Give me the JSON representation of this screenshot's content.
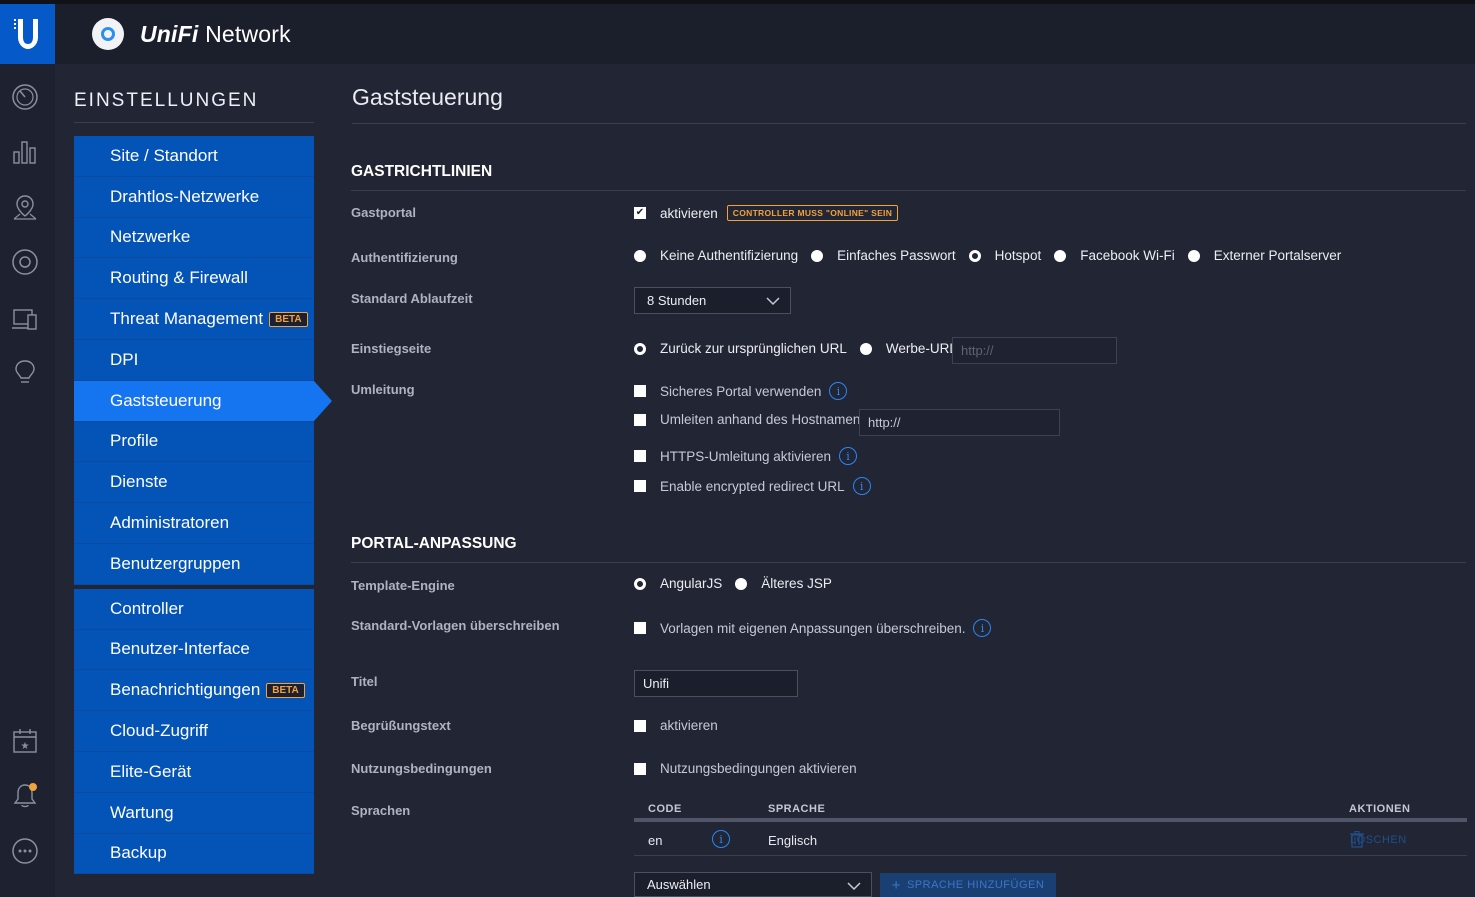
{
  "app": {
    "brand_prefix": "UniFi",
    "brand_suffix": "Network"
  },
  "sidebar": {
    "title": "EINSTELLUNGEN",
    "group1": [
      {
        "label": "Site / Standort"
      },
      {
        "label": "Drahtlos-Netzwerke"
      },
      {
        "label": "Netzwerke"
      },
      {
        "label": "Routing & Firewall"
      },
      {
        "label": "Threat Management",
        "badge": "BETA"
      },
      {
        "label": "DPI"
      },
      {
        "label": "Gaststeuerung",
        "active": true
      },
      {
        "label": "Profile"
      },
      {
        "label": "Dienste"
      },
      {
        "label": "Administratoren"
      },
      {
        "label": "Benutzergruppen"
      }
    ],
    "group2": [
      {
        "label": "Controller"
      },
      {
        "label": "Benutzer-Interface"
      },
      {
        "label": "Benachrichtigungen",
        "badge": "BETA"
      },
      {
        "label": "Cloud-Zugriff"
      },
      {
        "label": "Elite-Gerät"
      },
      {
        "label": "Wartung"
      },
      {
        "label": "Backup"
      }
    ]
  },
  "page": {
    "title": "Gaststeuerung"
  },
  "guest_policies": {
    "title": "GASTRICHTLINIEN",
    "gastportal": {
      "label": "Gastportal",
      "checkbox": "aktivieren",
      "checked": true,
      "badge": "CONTROLLER MUSS \"ONLINE\" SEIN"
    },
    "auth": {
      "label": "Authentifizierung",
      "options": [
        "Keine Authentifizierung",
        "Einfaches Passwort",
        "Hotspot",
        "Facebook Wi-Fi",
        "Externer Portalserver"
      ],
      "selected": "Hotspot"
    },
    "expiry": {
      "label": "Standard Ablaufzeit",
      "value": "8 Stunden"
    },
    "landing": {
      "label": "Einstiegseite",
      "option1": "Zurück zur ursprünglichen URL",
      "option2": "Werbe-URL",
      "selected": "Zurück zur ursprünglichen URL",
      "url_placeholder": "http://"
    },
    "redirect": {
      "label": "Umleitung",
      "secure_portal": "Sicheres Portal verwenden",
      "by_hostname": "Umleiten anhand des Hostnamen",
      "hostname_value": "http://",
      "https_redirect": "HTTPS-Umleitung aktivieren",
      "encrypted_url": "Enable encrypted redirect URL"
    }
  },
  "portal": {
    "title": "PORTAL-ANPASSUNG",
    "engine": {
      "label": "Template-Engine",
      "option1": "AngularJS",
      "option2": "Älteres JSP",
      "selected": "AngularJS"
    },
    "override": {
      "label": "Standard-Vorlagen überschreiben",
      "checkbox": "Vorlagen mit eigenen Anpassungen überschreiben."
    },
    "title_field": {
      "label": "Titel",
      "value": "Unifi"
    },
    "welcome": {
      "label": "Begrüßungstext",
      "checkbox": "aktivieren"
    },
    "terms": {
      "label": "Nutzungsbedingungen",
      "checkbox": "Nutzungsbedingungen aktivieren"
    },
    "languages": {
      "label": "Sprachen",
      "col_code": "CODE",
      "col_language": "SPRACHE",
      "col_actions": "AKTIONEN",
      "rows": [
        {
          "code": "en",
          "language": "Englisch",
          "action": "LÖSCHEN"
        }
      ],
      "select_value": "Auswählen",
      "add_button": "SPRACHE HINZUFÜGEN"
    }
  },
  "colors": {
    "nav_blue": "#0453b6",
    "nav_active": "#1574f0",
    "accent_orange": "#f0a33c",
    "info_blue": "#2a86f5"
  }
}
